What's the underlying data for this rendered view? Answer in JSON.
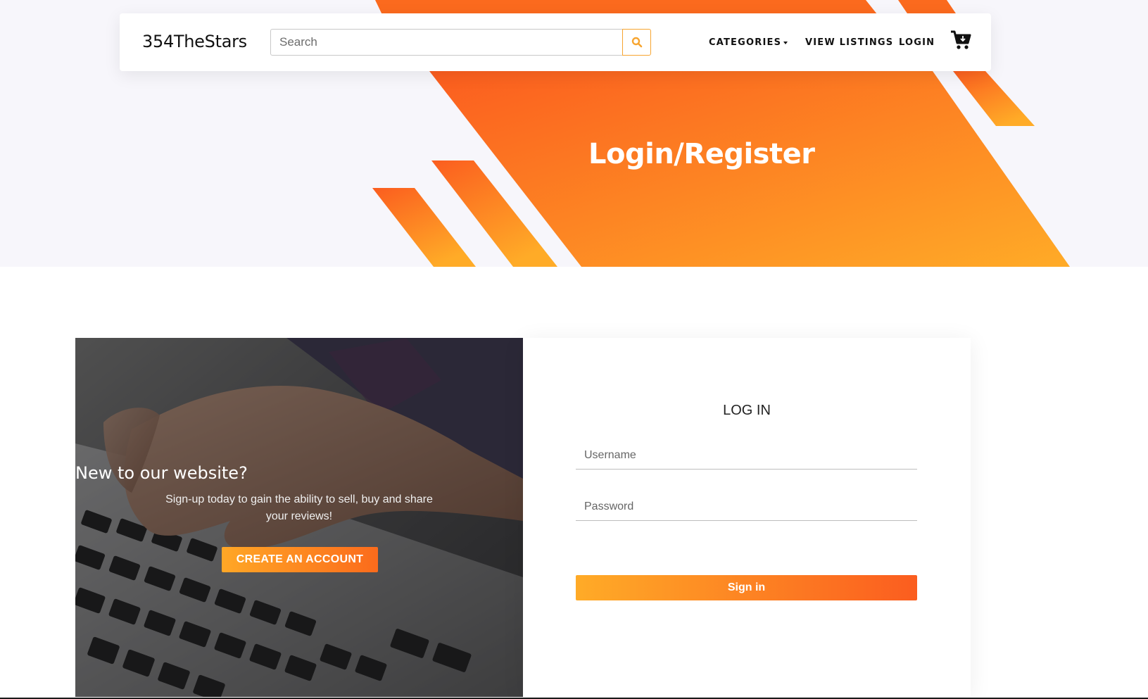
{
  "colors": {
    "accent_start": "#ffab27",
    "accent_end": "#fb5d1f",
    "hero_background": "#f7f6fb"
  },
  "navbar": {
    "brand": "354TheStars",
    "search_placeholder": "Search",
    "search_icon": "search-icon",
    "links": {
      "categories": "CATEGORIES",
      "view_listings": "VIEW LISTINGS",
      "login": "LOGIN"
    },
    "cart_icon": "cart-icon"
  },
  "hero": {
    "title": "Login/Register"
  },
  "register_panel": {
    "title": "New to our website?",
    "text": "Sign-up today to gain the ability to sell, buy and share your reviews!",
    "button": "CREATE AN ACCOUNT"
  },
  "login_panel": {
    "title": "LOG IN",
    "username_placeholder": "Username",
    "password_placeholder": "Password",
    "button": "Sign in"
  }
}
